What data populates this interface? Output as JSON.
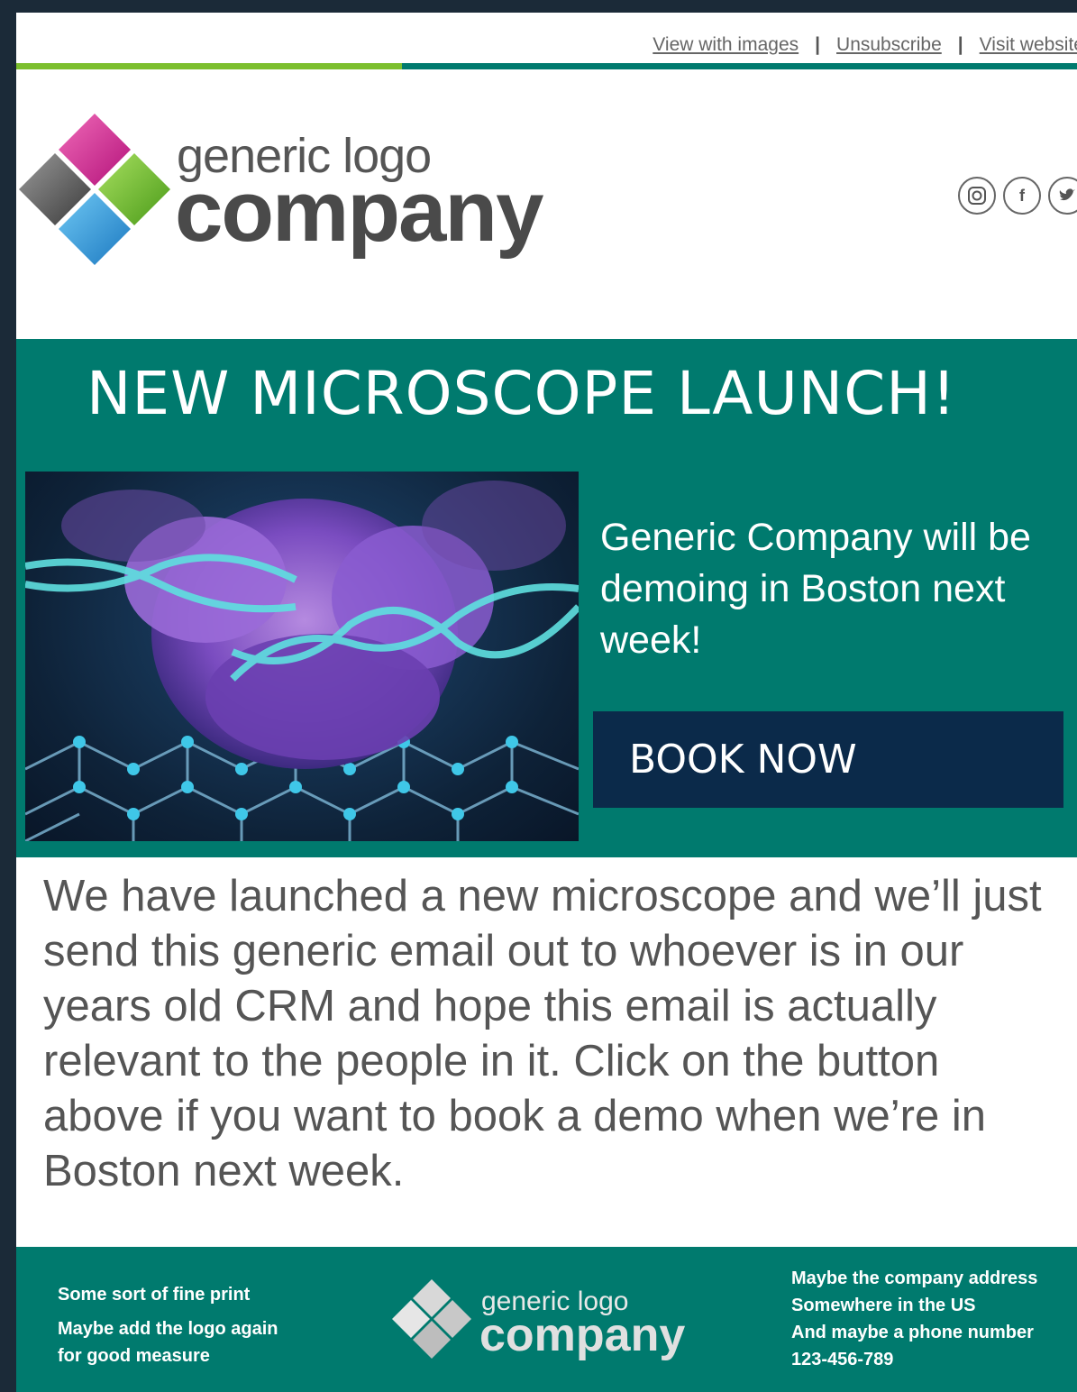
{
  "toplinks": {
    "view_images": "View with images",
    "unsubscribe": "Unsubscribe",
    "visit_website": "Visit website",
    "separator": "|"
  },
  "header": {
    "logo_tagline": "generic logo",
    "logo_word": "company",
    "social": [
      "instagram-icon",
      "facebook-icon",
      "twitter-icon"
    ]
  },
  "hero": {
    "title": "NEW MICROSCOPE LAUNCH!",
    "blurb": "Generic Company will be demoing in Boston next week!",
    "cta_label": "BOOK NOW"
  },
  "body": {
    "text": "We have launched a new microscope and we’ll just send this generic email out to whoever is in our years old CRM and hope this email is actually relevant to the people in it. Click on the button above if you want to book a demo when we’re in Boston next week."
  },
  "footer": {
    "fine_print": "Some sort of fine print",
    "logo_note_1": "Maybe add the logo again",
    "logo_note_2": "for good measure",
    "logo_tagline": "generic logo",
    "logo_word": "company",
    "address_1": "Maybe the company address",
    "address_2": "Somewhere in the US",
    "address_3": "And  maybe a phone number",
    "phone": "123-456-789"
  },
  "colors": {
    "teal": "#007a6e",
    "green_rule": "#7cbf2e",
    "navy_button": "#0b2a4a",
    "frame": "#1b2a38"
  }
}
